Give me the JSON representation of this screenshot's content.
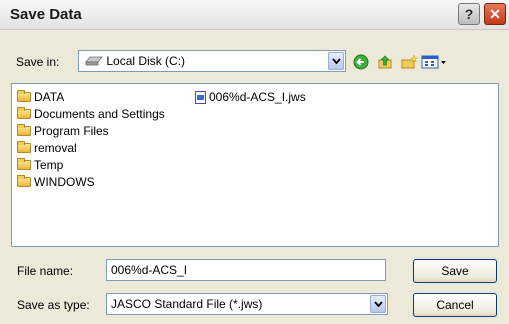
{
  "dialog": {
    "title": "Save Data"
  },
  "save_in": {
    "label": "Save in:",
    "value": "Local Disk (C:)"
  },
  "icons": [
    "drive-icon",
    "back-icon",
    "up-folder-icon",
    "new-folder-icon",
    "view-menu-icon"
  ],
  "folders": [
    "DATA",
    "Documents and Settings",
    "Program Files",
    "removal",
    "Temp",
    "WINDOWS"
  ],
  "files": [
    "006%d-ACS_I.jws"
  ],
  "file_name": {
    "label": "File name:",
    "value": "006%d-ACS_I"
  },
  "save_as_type": {
    "label": "Save as type:",
    "value": "JASCO Standard File (*.jws)"
  },
  "buttons": {
    "save": "Save",
    "cancel": "Cancel"
  },
  "titlebar": {
    "help": "?",
    "close": "✕"
  }
}
